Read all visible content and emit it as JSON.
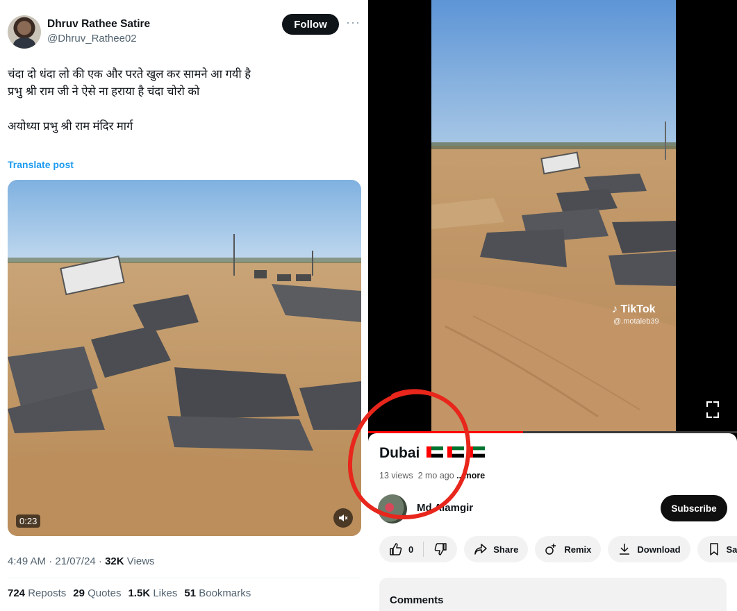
{
  "tweet": {
    "author_name": "Dhruv Rathee Satire",
    "author_handle": "@Dhruv_Rathee02",
    "follow_label": "Follow",
    "text_lines": [
      "चंदा दो धंदा लो की एक और परते खुल कर सामने आ गयी है",
      "प्रभु श्री राम जी ने ऐसे ना हराया है चंदा चोरो को",
      "",
      "अयोध्या प्रभु श्री राम मंदिर मार्ग"
    ],
    "translate_label": "Translate post",
    "video_duration": "0:23",
    "time": "4:49 AM · 21/07/24 · ",
    "views_count": "32K",
    "views_label": " Views",
    "stats": [
      {
        "count": "724",
        "label": "Reposts"
      },
      {
        "count": "29",
        "label": "Quotes"
      },
      {
        "count": "1.5K",
        "label": "Likes"
      },
      {
        "count": "51",
        "label": "Bookmarks"
      }
    ]
  },
  "youtube": {
    "watermark_brand": "TikTok",
    "watermark_handle": "@.motaleb39",
    "progress": 0.42,
    "title": "Dubai",
    "flag_count": 3,
    "views": "13 views",
    "age": "2 mo ago",
    "more_label": "...more",
    "channel_name": "Md Alamgir",
    "subscribe_label": "Subscribe",
    "like_count": "0",
    "share_label": "Share",
    "remix_label": "Remix",
    "download_label": "Download",
    "save_label": "Save",
    "comments_label": "Comments"
  },
  "colors": {
    "accent_link": "#1d9bf0",
    "yt_red": "#ff0000",
    "annotation_red": "#e8261c"
  }
}
